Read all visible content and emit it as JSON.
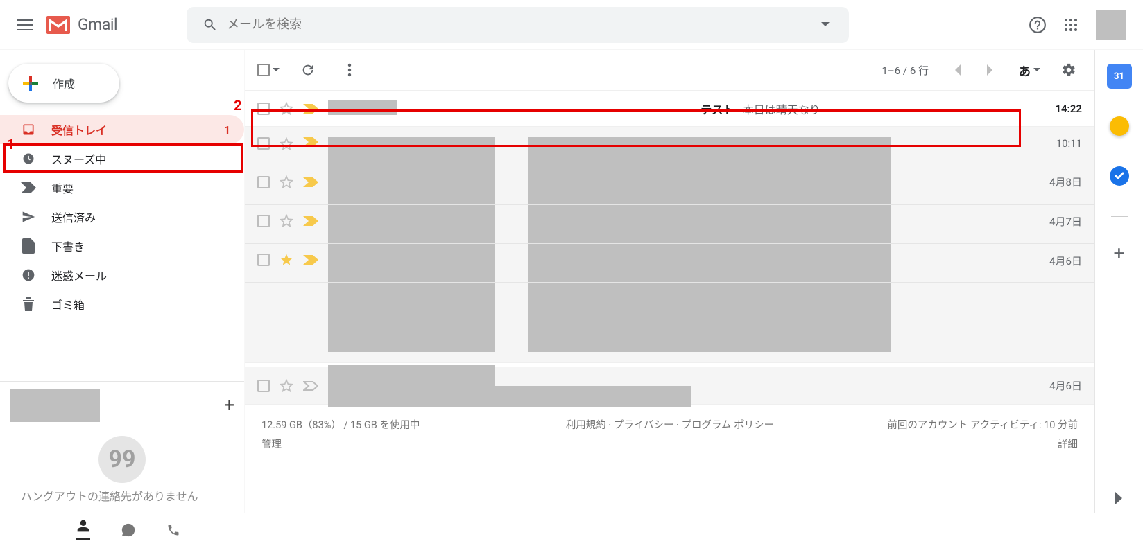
{
  "annotations": {
    "one": "1",
    "two": "2"
  },
  "header": {
    "brand": "Gmail",
    "search_placeholder": "メールを検索"
  },
  "compose": {
    "label": "作成"
  },
  "sidebar": {
    "items": [
      {
        "label": "受信トレイ",
        "count": "1",
        "icon": "inbox",
        "active": true
      },
      {
        "label": "スヌーズ中",
        "icon": "clock"
      },
      {
        "label": "重要",
        "icon": "important"
      },
      {
        "label": "送信済み",
        "icon": "send"
      },
      {
        "label": "下書き",
        "icon": "draft"
      },
      {
        "label": "迷惑メール",
        "icon": "spam"
      },
      {
        "label": "ゴミ箱",
        "icon": "trash"
      }
    ]
  },
  "hangouts": {
    "bubble": "99",
    "message": "ハングアウトの連絡先がありません"
  },
  "toolbar": {
    "pager": "1–6 / 6 行",
    "lang": "あ"
  },
  "mails": [
    {
      "subject_main": "テスト",
      "subject_rest": " - 本日は晴天なり",
      "time": "14:22",
      "unread": true,
      "starred": false,
      "important": true
    },
    {
      "time": "10:11",
      "starred": false,
      "important": true
    },
    {
      "time": "4月8日",
      "starred": false,
      "important": true
    },
    {
      "time": "4月7日",
      "starred": false,
      "important": true
    },
    {
      "time": "4月6日",
      "starred": true,
      "important": true
    },
    {
      "time": "4月6日",
      "starred": false,
      "important": false
    }
  ],
  "footer": {
    "storage_line1": "12.59 GB（83%） / 15 GB を使用中",
    "storage_line2": "管理",
    "policies": "利用規約 · プライバシー · プログラム ポリシー",
    "activity_line1": "前回のアカウント アクティビティ: 10 分前",
    "activity_line2": "詳細"
  },
  "sidepanel": {
    "calendar_day": "31"
  }
}
